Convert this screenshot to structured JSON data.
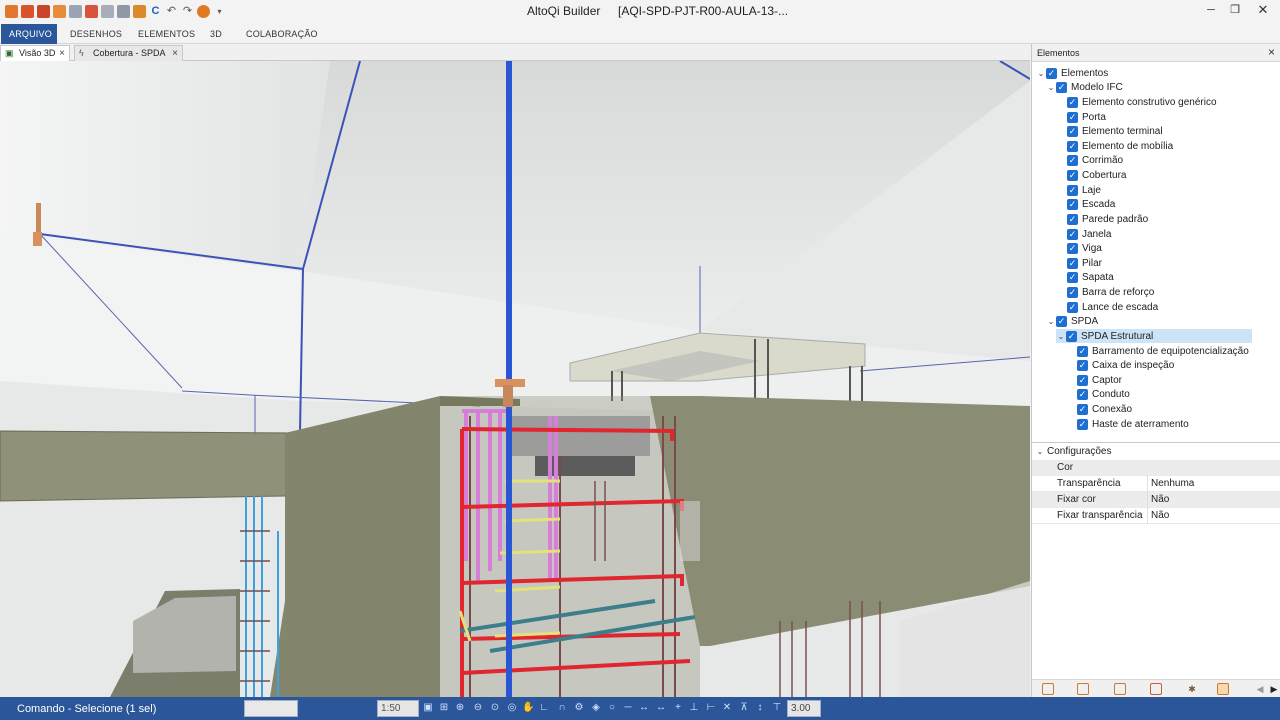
{
  "app": {
    "title": "AltoQi Builder",
    "file": "[AQI-SPD-PJT-R00-AULA-13-..."
  },
  "ribbon": {
    "tabs": [
      "ARQUIVO",
      "DESENHOS",
      "ELEMENTOS",
      "3D",
      "COLABORAÇÃO"
    ],
    "active": "ARQUIVO"
  },
  "doc_tabs": [
    {
      "label": "Visão 3D",
      "close": "×",
      "active": true
    },
    {
      "label": "Cobertura - SPDA",
      "close": "×",
      "active": false
    }
  ],
  "panel": {
    "title": "Elementos",
    "tree": [
      {
        "label": "Elementos",
        "level": 0,
        "expanded": true,
        "checked": true
      },
      {
        "label": "Modelo IFC",
        "level": 1,
        "expanded": true,
        "checked": true
      },
      {
        "label": "Elemento construtivo genérico",
        "level": 2,
        "checked": true
      },
      {
        "label": "Porta",
        "level": 2,
        "checked": true
      },
      {
        "label": "Elemento terminal",
        "level": 2,
        "checked": true
      },
      {
        "label": "Elemento de mobília",
        "level": 2,
        "checked": true
      },
      {
        "label": "Corrimão",
        "level": 2,
        "checked": true
      },
      {
        "label": "Cobertura",
        "level": 2,
        "checked": true
      },
      {
        "label": "Laje",
        "level": 2,
        "checked": true
      },
      {
        "label": "Escada",
        "level": 2,
        "checked": true
      },
      {
        "label": "Parede padrão",
        "level": 2,
        "checked": true
      },
      {
        "label": "Janela",
        "level": 2,
        "checked": true
      },
      {
        "label": "Viga",
        "level": 2,
        "checked": true
      },
      {
        "label": "Pilar",
        "level": 2,
        "checked": true
      },
      {
        "label": "Sapata",
        "level": 2,
        "checked": true
      },
      {
        "label": "Barra de reforço",
        "level": 2,
        "checked": true
      },
      {
        "label": "Lance de escada",
        "level": 2,
        "checked": true
      },
      {
        "label": "SPDA",
        "level": 1,
        "expanded": true,
        "checked": true
      },
      {
        "label": "SPDA Estrutural",
        "level": 2,
        "expanded": true,
        "checked": true,
        "selected": true
      },
      {
        "label": "Barramento de equipotencialização",
        "level": 3,
        "checked": true
      },
      {
        "label": "Caixa de inspeção",
        "level": 3,
        "checked": true
      },
      {
        "label": "Captor",
        "level": 3,
        "checked": true
      },
      {
        "label": "Conduto",
        "level": 3,
        "checked": true
      },
      {
        "label": "Conexão",
        "level": 3,
        "checked": true
      },
      {
        "label": "Haste de aterramento",
        "level": 3,
        "checked": true
      }
    ],
    "config": {
      "title": "Configurações",
      "props": [
        {
          "key": "Cor",
          "value": ""
        },
        {
          "key": "Transparência",
          "value": "Nenhuma"
        },
        {
          "key": "Fixar cor",
          "value": "Não"
        },
        {
          "key": "Fixar transparência",
          "value": "Não"
        }
      ]
    }
  },
  "status": {
    "command": "Comando - Selecione (1 sel)",
    "scale": "1:50",
    "zoom": "3.00"
  },
  "colors": {
    "accent": "#2b579a",
    "checkbox": "#1f6fd1",
    "concrete": "#8a8c73",
    "rebar_red": "#e0262e",
    "rebar_pink": "#d77ed8",
    "conductor_blue": "#2a55d4"
  },
  "icons": [
    "close-icon",
    "minimize-icon",
    "maximize-icon",
    "checkbox-icon",
    "chevron-down-icon",
    "chevron-right-icon",
    "chevron-left-icon"
  ]
}
